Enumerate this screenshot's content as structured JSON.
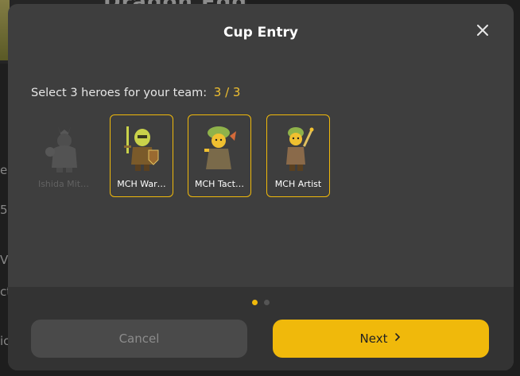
{
  "background": {
    "banner_title": "Dragon Egg",
    "fragments": [
      "e",
      "5",
      "V",
      "ct",
      "ic"
    ]
  },
  "modal": {
    "title": "Cup Entry",
    "close_icon": "close-icon",
    "instruction": "Select 3 heroes for your team:",
    "selected_count": "3 / 3",
    "heroes": [
      {
        "name": "Ishida Mit…",
        "selected": false,
        "disabled": true,
        "accent": "#9a9a9a"
      },
      {
        "name": "MCH War…",
        "selected": true,
        "disabled": false,
        "accent": "#c9d24a"
      },
      {
        "name": "MCH Tact…",
        "selected": true,
        "disabled": false,
        "accent": "#8fb24a"
      },
      {
        "name": "MCH Artist",
        "selected": true,
        "disabled": false,
        "accent": "#8fb24a"
      }
    ],
    "pagination": {
      "pages": 2,
      "current": 1
    },
    "cancel_label": "Cancel",
    "next_label": "Next",
    "next_icon": "chevron-right-icon"
  },
  "colors": {
    "accent": "#f0b90b",
    "modal_bg": "#3e3e3e",
    "footer_bg": "#333333"
  }
}
